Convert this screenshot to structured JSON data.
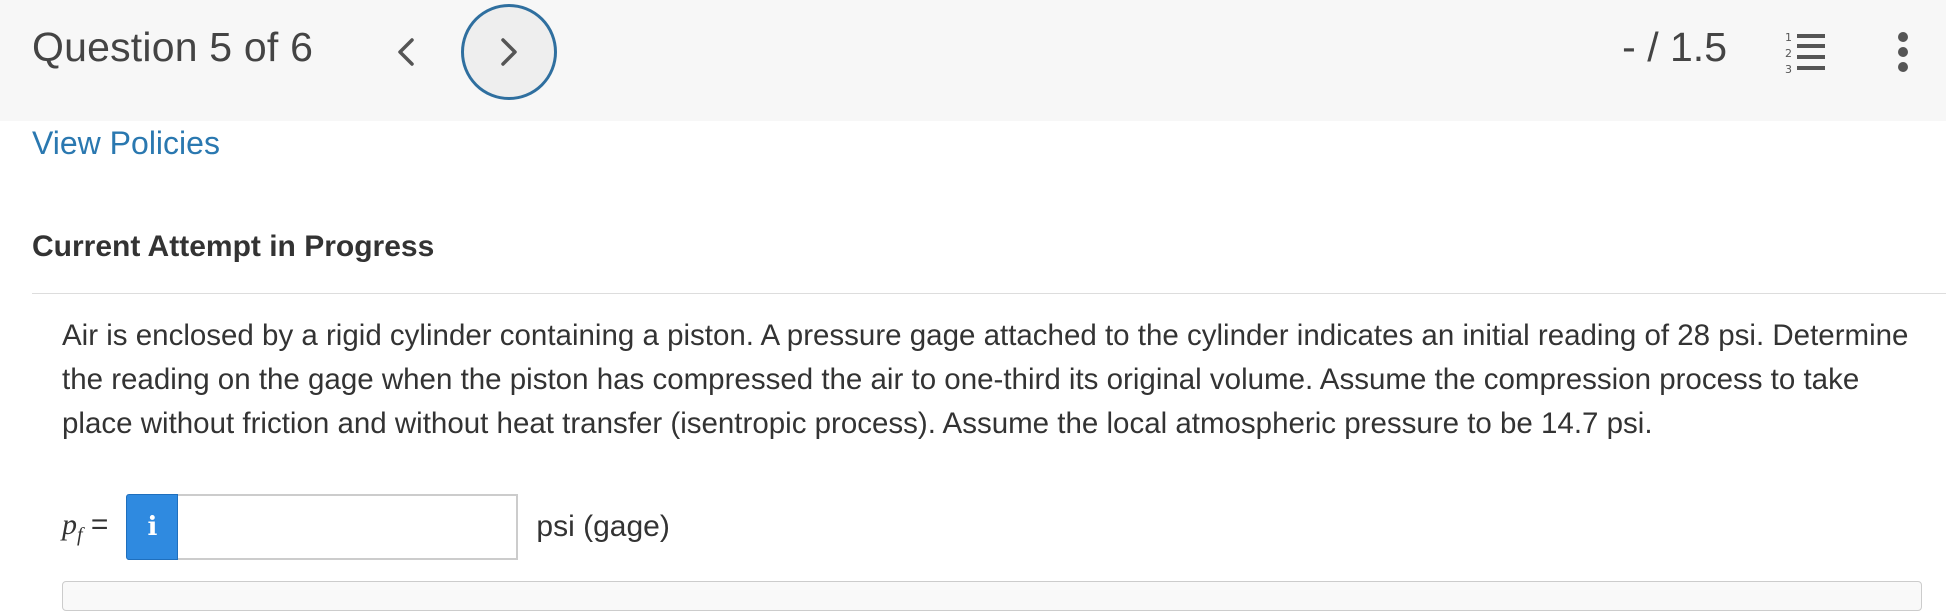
{
  "header": {
    "question_label": "Question 5 of 6",
    "score": "- / 1.5",
    "prev_icon": "chevron-left-icon",
    "next_icon": "chevron-right-icon",
    "list_icon": "numbered-list-icon",
    "more_icon": "vertical-ellipsis-icon"
  },
  "links": {
    "view_policies": "View Policies"
  },
  "attempt": {
    "heading": "Current Attempt in Progress"
  },
  "question": {
    "text": "Air is enclosed by a rigid cylinder containing a piston. A pressure gage attached to the cylinder indicates an initial reading of 28 psi. Determine the reading on the gage when the piston has compressed the air to one-third its original volume. Assume the compression process to take place without friction and without heat transfer (isentropic process). Assume the local atmospheric pressure to be 14.7 psi."
  },
  "answer": {
    "var_main": "p",
    "var_sub": "f",
    "equals": " =",
    "info_icon_label": "i",
    "input_value": "",
    "unit": "psi (gage)"
  },
  "colors": {
    "accent_link": "#2a78b0",
    "next_button_ring": "#2f6f9f",
    "info_button": "#2f8ae0"
  }
}
